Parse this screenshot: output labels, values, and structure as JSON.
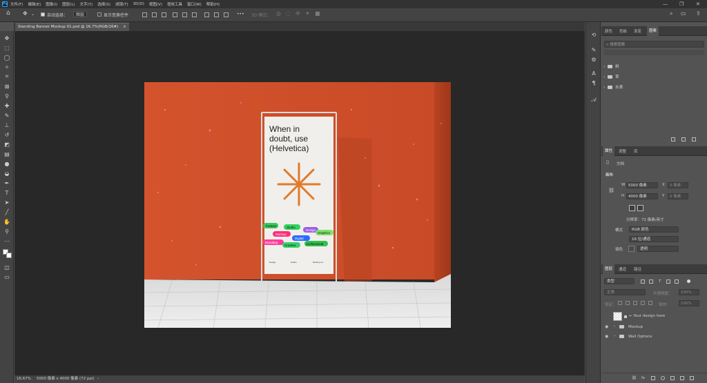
{
  "menu": {
    "logo": "Ps",
    "items": [
      "文件(F)",
      "编辑(E)",
      "图像(I)",
      "图层(L)",
      "文字(Y)",
      "选择(S)",
      "滤镜(T)",
      "3D(D)",
      "视图(V)",
      "增效工具",
      "窗口(W)",
      "帮助(H)"
    ],
    "win_controls": [
      "—",
      "❐",
      "✕"
    ]
  },
  "options": {
    "auto_select_label": "自动选择：",
    "auto_select_value": "图层",
    "show_transform_label": "显示变换控件",
    "mode3d_label": "3D 模式：",
    "more": "•••"
  },
  "document": {
    "tab_title": "Standing Banner Mockup 01.psd @ 16.7%(RGB/16#)",
    "tab_close": "×",
    "banner_headline": [
      "When in",
      "doubt, use",
      "(Helvetica)"
    ],
    "stickers": [
      "Design",
      "Mockup",
      "Branding",
      "Creative",
      "Studio",
      "Digital",
      "Feature",
      "professional",
      "Graphics"
    ],
    "banner_foot": [
      "Design",
      "Studio",
      "Mockup Co."
    ]
  },
  "status": {
    "zoom": "16.67%",
    "size": "5000 像素 x 4000 像素 (72 ppi)",
    "arrow": "›"
  },
  "layers_panel_top": {
    "tabs": [
      "颜色",
      "色板",
      "渐变",
      "图案"
    ],
    "active_tab": "图案",
    "search_placeholder": "搜索图案",
    "groups": [
      "树",
      "草",
      "水滴"
    ]
  },
  "properties": {
    "tabs": [
      "属性",
      "调整",
      "库"
    ],
    "active_tab": "属性",
    "doc_label": "文档",
    "canvas_label": "画布",
    "w_label": "W",
    "w_value": "5000 像素",
    "x_label": "X",
    "x_value": "0 像素",
    "h_label": "H",
    "h_value": "4000 像素",
    "y_label": "Y",
    "y_value": "0 像素",
    "resolution": "分辨率：72 像素/英寸",
    "mode_label": "模式",
    "mode_value": "RGB 颜色",
    "depth_value": "16 位/通道",
    "fill_label": "填色",
    "fill_value": "透明"
  },
  "layers": {
    "tabs": [
      "图层",
      "通道",
      "路径"
    ],
    "active_tab": "图层",
    "filter_value": "类型",
    "blend_value": "正常",
    "opacity_label": "不透明度：",
    "opacity_value": "100%",
    "lock_label": "锁定：",
    "fill_label": "填充：",
    "fill_value": "100%",
    "items": [
      {
        "name": "← Your design here",
        "type": "smart"
      },
      {
        "name": "Mockup",
        "type": "group"
      },
      {
        "name": "Wall Options",
        "type": "group"
      }
    ]
  },
  "colors": {
    "wall": "#d8542c",
    "accent_star": "#e07a2a",
    "ps_blue": "#31a8ff"
  }
}
